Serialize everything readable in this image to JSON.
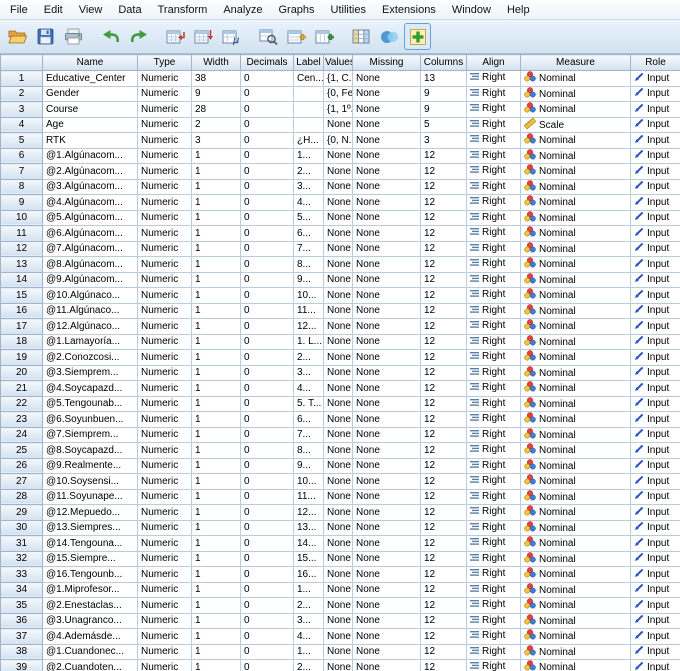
{
  "menu": {
    "items": [
      "File",
      "Edit",
      "View",
      "Data",
      "Transform",
      "Analyze",
      "Graphs",
      "Utilities",
      "Extensions",
      "Window",
      "Help"
    ]
  },
  "toolbar": {
    "buttons": [
      "open-data-button",
      "save-button",
      "print-button",
      "undo-button",
      "redo-button",
      "goto-case-button",
      "goto-variable-button",
      "variables-button",
      "find-button",
      "insert-cases-button",
      "insert-variable-button",
      "value-labels-button",
      "use-variable-sets-button",
      "show-all-variables-button"
    ]
  },
  "colors": {
    "toolbar_bg": "#d2e2f1",
    "header_gradient_top": "#f7fafd",
    "header_gradient_bottom": "#d3e1f0",
    "grid_line": "#bccbdd",
    "nominal_red": "#e8413c",
    "nominal_yellow": "#f7c23c",
    "nominal_blue": "#3f7fd0",
    "scale_yellow": "#f2c23e",
    "input_arrow_blue": "#2b50c8",
    "undo_green": "#3f9c3f"
  },
  "grid": {
    "headers": [
      "",
      "Name",
      "Type",
      "Width",
      "Decimals",
      "Label",
      "Values",
      "Missing",
      "Columns",
      "Align",
      "Measure",
      "Role"
    ],
    "rows": [
      {
        "num": 1,
        "name": "Educative_Center",
        "type": "Numeric",
        "width": "38",
        "decimals": "0",
        "label": "Cen...",
        "values": "{1, C...",
        "missing": "None",
        "columns": "13",
        "align": "Right",
        "measure": "Nominal",
        "role": "Input"
      },
      {
        "num": 2,
        "name": "Gender",
        "type": "Numeric",
        "width": "9",
        "decimals": "0",
        "label": "",
        "values": "{0, Fe...",
        "missing": "None",
        "columns": "9",
        "align": "Right",
        "measure": "Nominal",
        "role": "Input"
      },
      {
        "num": 3,
        "name": "Course",
        "type": "Numeric",
        "width": "28",
        "decimals": "0",
        "label": "",
        "values": "{1, 1º...",
        "missing": "None",
        "columns": "9",
        "align": "Right",
        "measure": "Nominal",
        "role": "Input"
      },
      {
        "num": 4,
        "name": "Age",
        "type": "Numeric",
        "width": "2",
        "decimals": "0",
        "label": "",
        "values": "None",
        "missing": "None",
        "columns": "5",
        "align": "Right",
        "measure": "Scale",
        "role": "Input"
      },
      {
        "num": 5,
        "name": "RTK",
        "type": "Numeric",
        "width": "3",
        "decimals": "0",
        "label": "¿H...",
        "values": "{0, N...",
        "missing": "None",
        "columns": "3",
        "align": "Right",
        "measure": "Nominal",
        "role": "Input"
      },
      {
        "num": 6,
        "name": "@1.Algúnacom...",
        "type": "Numeric",
        "width": "1",
        "decimals": "0",
        "label": "1...",
        "values": "None",
        "missing": "None",
        "columns": "12",
        "align": "Right",
        "measure": "Nominal",
        "role": "Input"
      },
      {
        "num": 7,
        "name": "@2.Algúnacom...",
        "type": "Numeric",
        "width": "1",
        "decimals": "0",
        "label": "2...",
        "values": "None",
        "missing": "None",
        "columns": "12",
        "align": "Right",
        "measure": "Nominal",
        "role": "Input"
      },
      {
        "num": 8,
        "name": "@3.Algúnacom...",
        "type": "Numeric",
        "width": "1",
        "decimals": "0",
        "label": "3...",
        "values": "None",
        "missing": "None",
        "columns": "12",
        "align": "Right",
        "measure": "Nominal",
        "role": "Input"
      },
      {
        "num": 9,
        "name": "@4.Algúnacom...",
        "type": "Numeric",
        "width": "1",
        "decimals": "0",
        "label": "4...",
        "values": "None",
        "missing": "None",
        "columns": "12",
        "align": "Right",
        "measure": "Nominal",
        "role": "Input"
      },
      {
        "num": 10,
        "name": "@5.Algúnacom...",
        "type": "Numeric",
        "width": "1",
        "decimals": "0",
        "label": "5...",
        "values": "None",
        "missing": "None",
        "columns": "12",
        "align": "Right",
        "measure": "Nominal",
        "role": "Input"
      },
      {
        "num": 11,
        "name": "@6.Algúnacom...",
        "type": "Numeric",
        "width": "1",
        "decimals": "0",
        "label": "6...",
        "values": "None",
        "missing": "None",
        "columns": "12",
        "align": "Right",
        "measure": "Nominal",
        "role": "Input"
      },
      {
        "num": 12,
        "name": "@7.Algúnacom...",
        "type": "Numeric",
        "width": "1",
        "decimals": "0",
        "label": "7...",
        "values": "None",
        "missing": "None",
        "columns": "12",
        "align": "Right",
        "measure": "Nominal",
        "role": "Input"
      },
      {
        "num": 13,
        "name": "@8.Algúnacom...",
        "type": "Numeric",
        "width": "1",
        "decimals": "0",
        "label": "8...",
        "values": "None",
        "missing": "None",
        "columns": "12",
        "align": "Right",
        "measure": "Nominal",
        "role": "Input"
      },
      {
        "num": 14,
        "name": "@9.Algúnacom...",
        "type": "Numeric",
        "width": "1",
        "decimals": "0",
        "label": "9...",
        "values": "None",
        "missing": "None",
        "columns": "12",
        "align": "Right",
        "measure": "Nominal",
        "role": "Input"
      },
      {
        "num": 15,
        "name": "@10.Algúnaco...",
        "type": "Numeric",
        "width": "1",
        "decimals": "0",
        "label": "10...",
        "values": "None",
        "missing": "None",
        "columns": "12",
        "align": "Right",
        "measure": "Nominal",
        "role": "Input"
      },
      {
        "num": 16,
        "name": "@11.Algúnaco...",
        "type": "Numeric",
        "width": "1",
        "decimals": "0",
        "label": "11...",
        "values": "None",
        "missing": "None",
        "columns": "12",
        "align": "Right",
        "measure": "Nominal",
        "role": "Input"
      },
      {
        "num": 17,
        "name": "@12.Algúnaco...",
        "type": "Numeric",
        "width": "1",
        "decimals": "0",
        "label": "12...",
        "values": "None",
        "missing": "None",
        "columns": "12",
        "align": "Right",
        "measure": "Nominal",
        "role": "Input"
      },
      {
        "num": 18,
        "name": "@1.Lamayoría...",
        "type": "Numeric",
        "width": "1",
        "decimals": "0",
        "label": "1. L...",
        "values": "None",
        "missing": "None",
        "columns": "12",
        "align": "Right",
        "measure": "Nominal",
        "role": "Input"
      },
      {
        "num": 19,
        "name": "@2.Conozcosi...",
        "type": "Numeric",
        "width": "1",
        "decimals": "0",
        "label": "2...",
        "values": "None",
        "missing": "None",
        "columns": "12",
        "align": "Right",
        "measure": "Nominal",
        "role": "Input"
      },
      {
        "num": 20,
        "name": "@3.Siemprem...",
        "type": "Numeric",
        "width": "1",
        "decimals": "0",
        "label": "3...",
        "values": "None",
        "missing": "None",
        "columns": "12",
        "align": "Right",
        "measure": "Nominal",
        "role": "Input"
      },
      {
        "num": 21,
        "name": "@4.Soycapazd...",
        "type": "Numeric",
        "width": "1",
        "decimals": "0",
        "label": "4...",
        "values": "None",
        "missing": "None",
        "columns": "12",
        "align": "Right",
        "measure": "Nominal",
        "role": "Input"
      },
      {
        "num": 22,
        "name": "@5.Tengounab...",
        "type": "Numeric",
        "width": "1",
        "decimals": "0",
        "label": "5. T...",
        "values": "None",
        "missing": "None",
        "columns": "12",
        "align": "Right",
        "measure": "Nominal",
        "role": "Input"
      },
      {
        "num": 23,
        "name": "@6.Soyunbuen...",
        "type": "Numeric",
        "width": "1",
        "decimals": "0",
        "label": "6...",
        "values": "None",
        "missing": "None",
        "columns": "12",
        "align": "Right",
        "measure": "Nominal",
        "role": "Input"
      },
      {
        "num": 24,
        "name": "@7.Siemprem...",
        "type": "Numeric",
        "width": "1",
        "decimals": "0",
        "label": "7...",
        "values": "None",
        "missing": "None",
        "columns": "12",
        "align": "Right",
        "measure": "Nominal",
        "role": "Input"
      },
      {
        "num": 25,
        "name": "@8.Soycapazd...",
        "type": "Numeric",
        "width": "1",
        "decimals": "0",
        "label": "8...",
        "values": "None",
        "missing": "None",
        "columns": "12",
        "align": "Right",
        "measure": "Nominal",
        "role": "Input"
      },
      {
        "num": 26,
        "name": "@9.Realmente...",
        "type": "Numeric",
        "width": "1",
        "decimals": "0",
        "label": "9...",
        "values": "None",
        "missing": "None",
        "columns": "12",
        "align": "Right",
        "measure": "Nominal",
        "role": "Input"
      },
      {
        "num": 27,
        "name": "@10.Soysensi...",
        "type": "Numeric",
        "width": "1",
        "decimals": "0",
        "label": "10...",
        "values": "None",
        "missing": "None",
        "columns": "12",
        "align": "Right",
        "measure": "Nominal",
        "role": "Input"
      },
      {
        "num": 28,
        "name": "@11.Soyunape...",
        "type": "Numeric",
        "width": "1",
        "decimals": "0",
        "label": "11...",
        "values": "None",
        "missing": "None",
        "columns": "12",
        "align": "Right",
        "measure": "Nominal",
        "role": "Input"
      },
      {
        "num": 29,
        "name": "@12.Mepuedo...",
        "type": "Numeric",
        "width": "1",
        "decimals": "0",
        "label": "12...",
        "values": "None",
        "missing": "None",
        "columns": "12",
        "align": "Right",
        "measure": "Nominal",
        "role": "Input"
      },
      {
        "num": 30,
        "name": "@13.Siempres...",
        "type": "Numeric",
        "width": "1",
        "decimals": "0",
        "label": "13...",
        "values": "None",
        "missing": "None",
        "columns": "12",
        "align": "Right",
        "measure": "Nominal",
        "role": "Input"
      },
      {
        "num": 31,
        "name": "@14.Tengouna...",
        "type": "Numeric",
        "width": "1",
        "decimals": "0",
        "label": "14...",
        "values": "None",
        "missing": "None",
        "columns": "12",
        "align": "Right",
        "measure": "Nominal",
        "role": "Input"
      },
      {
        "num": 32,
        "name": "@15.Siempre...",
        "type": "Numeric",
        "width": "1",
        "decimals": "0",
        "label": "15...",
        "values": "None",
        "missing": "None",
        "columns": "12",
        "align": "Right",
        "measure": "Nominal",
        "role": "Input"
      },
      {
        "num": 33,
        "name": "@16.Tengounb...",
        "type": "Numeric",
        "width": "1",
        "decimals": "0",
        "label": "16...",
        "values": "None",
        "missing": "None",
        "columns": "12",
        "align": "Right",
        "measure": "Nominal",
        "role": "Input"
      },
      {
        "num": 34,
        "name": "@1.Miprofesor...",
        "type": "Numeric",
        "width": "1",
        "decimals": "0",
        "label": "1...",
        "values": "None",
        "missing": "None",
        "columns": "12",
        "align": "Right",
        "measure": "Nominal",
        "role": "Input"
      },
      {
        "num": 35,
        "name": "@2.Enestaclas...",
        "type": "Numeric",
        "width": "1",
        "decimals": "0",
        "label": "2...",
        "values": "None",
        "missing": "None",
        "columns": "12",
        "align": "Right",
        "measure": "Nominal",
        "role": "Input"
      },
      {
        "num": 36,
        "name": "@3.Unagranco...",
        "type": "Numeric",
        "width": "1",
        "decimals": "0",
        "label": "3...",
        "values": "None",
        "missing": "None",
        "columns": "12",
        "align": "Right",
        "measure": "Nominal",
        "role": "Input"
      },
      {
        "num": 37,
        "name": "@4.Ademásde...",
        "type": "Numeric",
        "width": "1",
        "decimals": "0",
        "label": "4...",
        "values": "None",
        "missing": "None",
        "columns": "12",
        "align": "Right",
        "measure": "Nominal",
        "role": "Input"
      },
      {
        "num": 38,
        "name": "@1.Cuandonec...",
        "type": "Numeric",
        "width": "1",
        "decimals": "0",
        "label": "1...",
        "values": "None",
        "missing": "None",
        "columns": "12",
        "align": "Right",
        "measure": "Nominal",
        "role": "Input"
      },
      {
        "num": 39,
        "name": "@2.Cuandoten...",
        "type": "Numeric",
        "width": "1",
        "decimals": "0",
        "label": "2...",
        "values": "None",
        "missing": "None",
        "columns": "12",
        "align": "Right",
        "measure": "Nominal",
        "role": "Input"
      }
    ]
  }
}
